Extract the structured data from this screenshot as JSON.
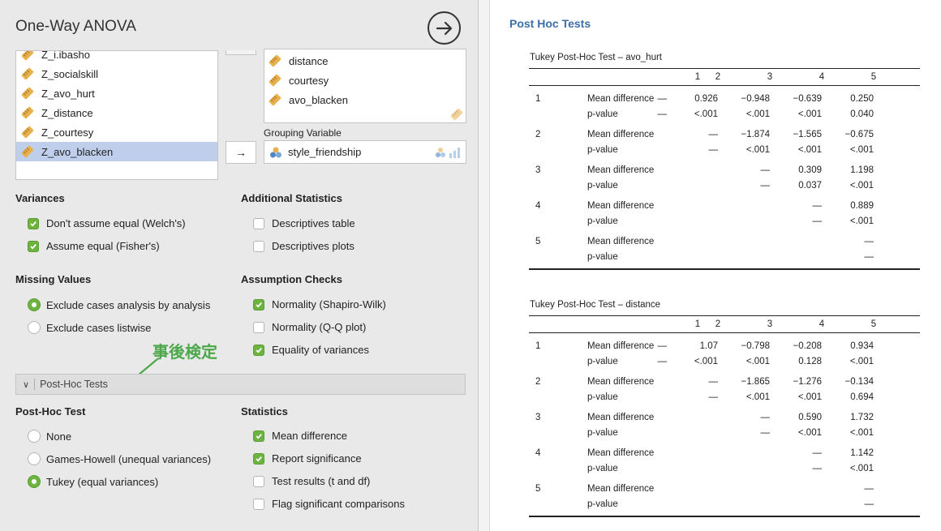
{
  "header": {
    "title": "One-Way ANOVA"
  },
  "varlist": [
    "Z_i.ibasho",
    "Z_socialskill",
    "Z_avo_hurt",
    "Z_distance",
    "Z_courtesy",
    "Z_avo_blacken"
  ],
  "dependent": [
    "distance",
    "courtesy",
    "avo_blacken"
  ],
  "grouping": {
    "label": "Grouping Variable",
    "value": "style_friendship",
    "move_arrow": "→"
  },
  "variances": {
    "heading": "Variances",
    "options": [
      {
        "label": "Don't assume equal (Welch's)",
        "checked": true
      },
      {
        "label": "Assume equal (Fisher's)",
        "checked": true
      }
    ]
  },
  "additional": {
    "heading": "Additional Statistics",
    "options": [
      {
        "label": "Descriptives table",
        "checked": false
      },
      {
        "label": "Descriptives plots",
        "checked": false
      }
    ]
  },
  "missing": {
    "heading": "Missing Values",
    "options": [
      {
        "label": "Exclude cases analysis by analysis",
        "selected": true
      },
      {
        "label": "Exclude cases listwise",
        "selected": false
      }
    ]
  },
  "assumption": {
    "heading": "Assumption Checks",
    "options": [
      {
        "label": "Normality (Shapiro-Wilk)",
        "checked": true
      },
      {
        "label": "Normality (Q-Q plot)",
        "checked": false
      },
      {
        "label": "Equality of variances",
        "checked": true
      }
    ]
  },
  "annotation": "事後検定",
  "posthoc_section": {
    "label": "Post-Hoc Tests",
    "chevron": "∨"
  },
  "posthoc_test": {
    "heading": "Post-Hoc Test",
    "options": [
      {
        "label": "None",
        "selected": false
      },
      {
        "label": "Games-Howell (unequal variances)",
        "selected": false
      },
      {
        "label": "Tukey (equal variances)",
        "selected": true
      }
    ]
  },
  "statistics": {
    "heading": "Statistics",
    "options": [
      {
        "label": "Mean difference",
        "checked": true
      },
      {
        "label": "Report significance",
        "checked": true
      },
      {
        "label": "Test results (t and df)",
        "checked": false
      },
      {
        "label": "Flag significant comparisons",
        "checked": false
      }
    ]
  },
  "results": {
    "title": "Post Hoc Tests",
    "columns": [
      "1",
      "2",
      "3",
      "4",
      "5"
    ],
    "row_labels": [
      "Mean difference",
      "p-value"
    ],
    "tables": [
      {
        "caption": "Tukey Post-Hoc Test – avo_hurt",
        "rows": [
          {
            "group": "1",
            "md": [
              "—",
              "0.926",
              "−0.948",
              "−0.639",
              "0.250"
            ],
            "p": [
              "—",
              "<.001",
              "<.001",
              "<.001",
              "0.040"
            ]
          },
          {
            "group": "2",
            "md": [
              "",
              "—",
              "−1.874",
              "−1.565",
              "−0.675"
            ],
            "p": [
              "",
              "—",
              "<.001",
              "<.001",
              "<.001"
            ]
          },
          {
            "group": "3",
            "md": [
              "",
              "",
              "—",
              "0.309",
              "1.198"
            ],
            "p": [
              "",
              "",
              "—",
              "0.037",
              "<.001"
            ]
          },
          {
            "group": "4",
            "md": [
              "",
              "",
              "",
              "—",
              "0.889"
            ],
            "p": [
              "",
              "",
              "",
              "—",
              "<.001"
            ]
          },
          {
            "group": "5",
            "md": [
              "",
              "",
              "",
              "",
              "—"
            ],
            "p": [
              "",
              "",
              "",
              "",
              "—"
            ]
          }
        ]
      },
      {
        "caption": "Tukey Post-Hoc Test – distance",
        "rows": [
          {
            "group": "1",
            "md": [
              "—",
              "1.07",
              "−0.798",
              "−0.208",
              "0.934"
            ],
            "p": [
              "—",
              "<.001",
              "<.001",
              "0.128",
              "<.001"
            ]
          },
          {
            "group": "2",
            "md": [
              "",
              "—",
              "−1.865",
              "−1.276",
              "−0.134"
            ],
            "p": [
              "",
              "—",
              "<.001",
              "<.001",
              "0.694"
            ]
          },
          {
            "group": "3",
            "md": [
              "",
              "",
              "—",
              "0.590",
              "1.732"
            ],
            "p": [
              "",
              "",
              "—",
              "<.001",
              "<.001"
            ]
          },
          {
            "group": "4",
            "md": [
              "",
              "",
              "",
              "—",
              "1.142"
            ],
            "p": [
              "",
              "",
              "",
              "—",
              "<.001"
            ]
          },
          {
            "group": "5",
            "md": [
              "",
              "",
              "",
              "",
              "—"
            ],
            "p": [
              "",
              "",
              "",
              "",
              "—"
            ]
          }
        ]
      }
    ]
  }
}
